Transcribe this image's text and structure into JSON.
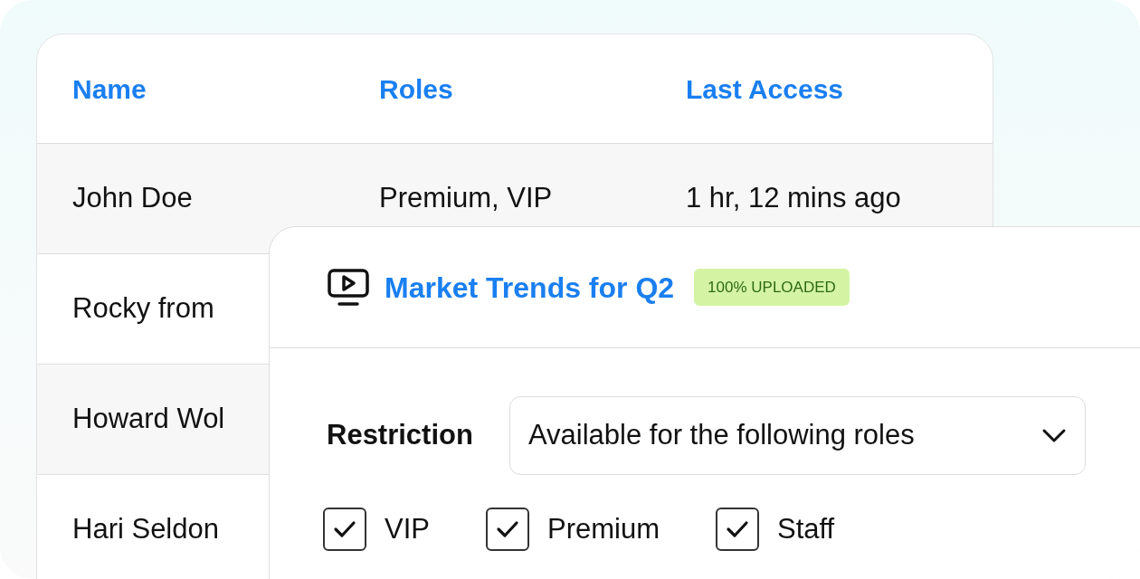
{
  "table": {
    "columns": [
      "Name",
      "Roles",
      "Last Access"
    ],
    "rows": [
      {
        "cells": [
          "John Doe",
          "Premium, VIP",
          "1 hr, 12 mins ago"
        ]
      },
      {
        "cells": [
          "Rocky from"
        ]
      },
      {
        "cells": [
          "Howard Wol"
        ]
      },
      {
        "cells": [
          "Hari Seldon"
        ]
      }
    ]
  },
  "card": {
    "title": "Market Trends for Q2",
    "badge": "100% UPLOADED",
    "restriction": {
      "label": "Restriction",
      "value": "Available for the following roles"
    },
    "roles": [
      {
        "label": "VIP",
        "checked": true
      },
      {
        "label": "Premium",
        "checked": true
      },
      {
        "label": "Staff",
        "checked": true
      }
    ]
  }
}
